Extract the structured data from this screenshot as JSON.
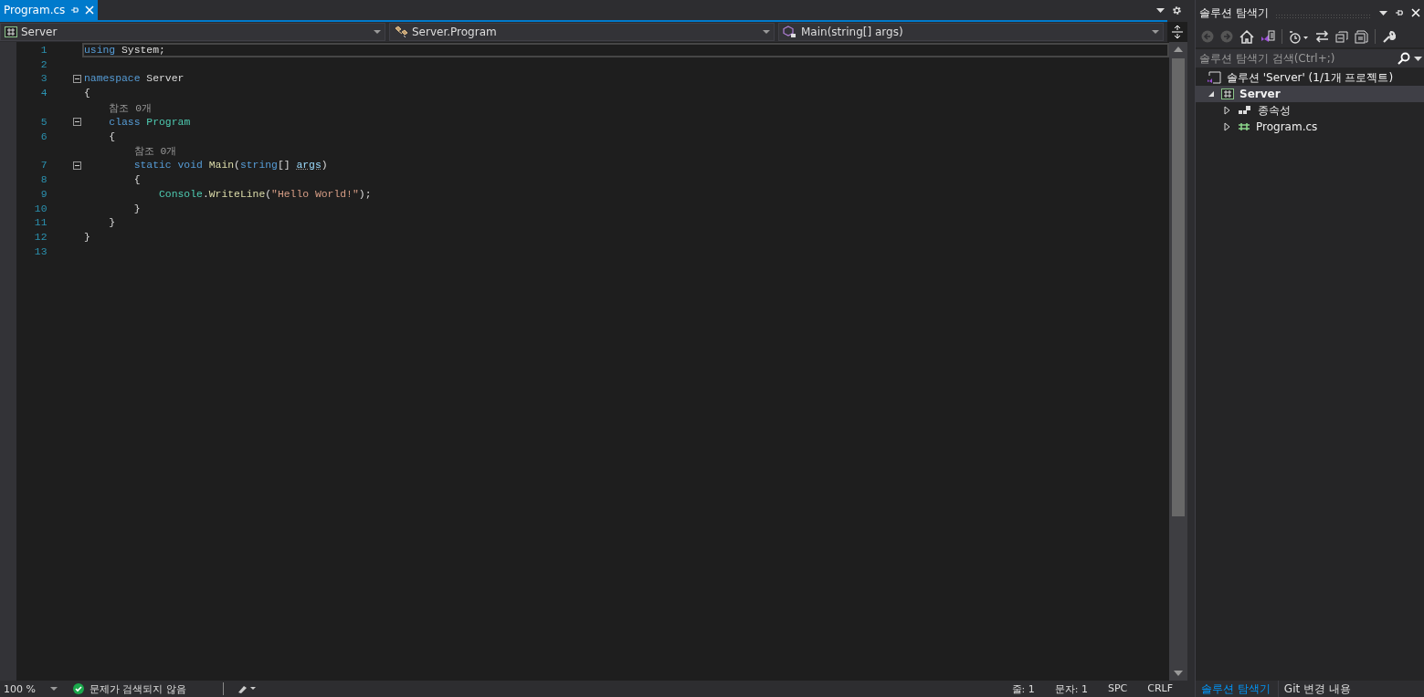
{
  "document_tab": {
    "title": "Program.cs",
    "selected": true
  },
  "nav_bar": {
    "project": "Server",
    "type": "Server.Program",
    "member": "Main(string[] args)"
  },
  "code": [
    {
      "kind": "code",
      "number": "1",
      "current": true,
      "tokens": [
        {
          "kind": "keyword",
          "text": "using"
        },
        {
          "kind": "plain",
          "text": " System;"
        }
      ]
    },
    {
      "kind": "code",
      "number": "2",
      "current": false
    },
    {
      "kind": "code",
      "number": "3",
      "current": false,
      "expanded": true,
      "tokens": [
        {
          "kind": "keyword",
          "text": "namespace"
        },
        {
          "kind": "plain",
          "text": " Server"
        }
      ]
    },
    {
      "kind": "code",
      "number": "4",
      "current": false,
      "tokens": [
        {
          "kind": "plain",
          "text": "{"
        }
      ]
    },
    {
      "kind": "lens",
      "text": "    참조 0개"
    },
    {
      "kind": "code",
      "number": "5",
      "current": false,
      "expanded": true,
      "tokens": [
        {
          "kind": "keyword",
          "text": "    class"
        },
        {
          "kind": "type",
          "text": " Program"
        }
      ]
    },
    {
      "kind": "code",
      "number": "6",
      "current": false,
      "tokens": [
        {
          "kind": "plain",
          "text": "    {"
        }
      ]
    },
    {
      "kind": "lens",
      "text": "        참조 0개"
    },
    {
      "kind": "code",
      "number": "7",
      "current": false,
      "expanded": true,
      "tokens": [
        {
          "kind": "keyword",
          "text": "        static void"
        },
        {
          "kind": "method",
          "text": " Main"
        },
        {
          "kind": "plain",
          "text": "("
        },
        {
          "kind": "keyword",
          "text": "string"
        },
        {
          "kind": "plain",
          "text": "[] "
        },
        {
          "kind": "unused",
          "text": "args"
        },
        {
          "kind": "plain",
          "text": ")"
        }
      ]
    },
    {
      "kind": "code",
      "number": "8",
      "current": false,
      "tokens": [
        {
          "kind": "plain",
          "text": "        {"
        }
      ]
    },
    {
      "kind": "code",
      "number": "9",
      "current": false,
      "tokens": [
        {
          "kind": "type",
          "text": "            Console"
        },
        {
          "kind": "plain",
          "text": "."
        },
        {
          "kind": "method",
          "text": "WriteLine"
        },
        {
          "kind": "plain",
          "text": "("
        },
        {
          "kind": "string",
          "text": "\"Hello World!\""
        },
        {
          "kind": "plain",
          "text": ");"
        }
      ]
    },
    {
      "kind": "code",
      "number": "10",
      "current": false,
      "tokens": [
        {
          "kind": "plain",
          "text": "        }"
        }
      ]
    },
    {
      "kind": "code",
      "number": "11",
      "current": false,
      "tokens": [
        {
          "kind": "plain",
          "text": "    }"
        }
      ]
    },
    {
      "kind": "code",
      "number": "12",
      "current": false,
      "tokens": [
        {
          "kind": "plain",
          "text": "}"
        }
      ]
    },
    {
      "kind": "code",
      "number": "13",
      "current": false
    }
  ],
  "status_bar": {
    "zoom": "100 %",
    "issues": "문제가 검색되지 않음",
    "line": "줄: 1",
    "column": "문자: 1",
    "whitespace": "SPC",
    "line_ending": "CRLF"
  },
  "solution_explorer": {
    "title": "솔루션 탐색기",
    "search": {
      "placeholder": "솔루션 탐색기 검색(Ctrl+;)"
    },
    "tree": [
      {
        "label": "솔루션 'Server' (1/1개 프로젝트)",
        "kind": "solution",
        "selected": false,
        "children": [
          {
            "label": "Server",
            "kind": "project",
            "selected": true,
            "expanded": true,
            "children": [
              {
                "label": "종속성",
                "kind": "dependencies",
                "selected": false,
                "expanded": false
              },
              {
                "label": "Program.cs",
                "kind": "csfile",
                "selected": false,
                "expanded": false
              }
            ]
          }
        ]
      }
    ]
  },
  "bottom_tabs": [
    {
      "label": "솔루션 탐색기",
      "selected": true
    },
    {
      "label": "Git 변경 내용",
      "selected": false
    }
  ]
}
